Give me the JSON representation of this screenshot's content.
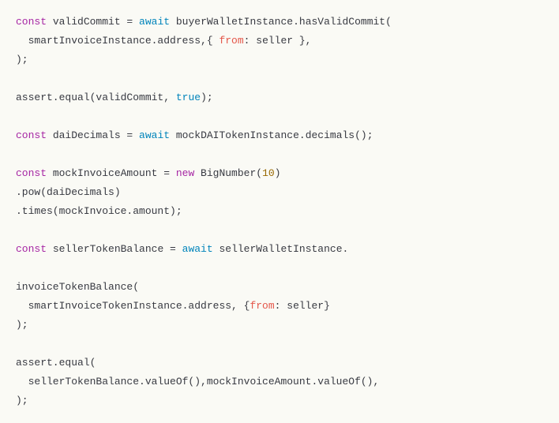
{
  "code": {
    "tokens": [
      {
        "cls": "tok-keyword",
        "t": "const"
      },
      {
        "cls": "tok-plain",
        "t": " validCommit = "
      },
      {
        "cls": "tok-await",
        "t": "await"
      },
      {
        "cls": "tok-plain",
        "t": " buyerWalletInstance.hasValidCommit(\n  smartInvoiceInstance.address,{ "
      },
      {
        "cls": "tok-prop",
        "t": "from"
      },
      {
        "cls": "tok-plain",
        "t": ": seller },\n);\n\nassert.equal(validCommit, "
      },
      {
        "cls": "tok-bool",
        "t": "true"
      },
      {
        "cls": "tok-plain",
        "t": ");\n\n"
      },
      {
        "cls": "tok-keyword",
        "t": "const"
      },
      {
        "cls": "tok-plain",
        "t": " daiDecimals = "
      },
      {
        "cls": "tok-await",
        "t": "await"
      },
      {
        "cls": "tok-plain",
        "t": " mockDAITokenInstance.decimals();\n\n"
      },
      {
        "cls": "tok-keyword",
        "t": "const"
      },
      {
        "cls": "tok-plain",
        "t": " mockInvoiceAmount = "
      },
      {
        "cls": "tok-keyword",
        "t": "new"
      },
      {
        "cls": "tok-plain",
        "t": " BigNumber("
      },
      {
        "cls": "tok-number",
        "t": "10"
      },
      {
        "cls": "tok-plain",
        "t": ")\n.pow(daiDecimals)\n.times(mockInvoice.amount);\n\n"
      },
      {
        "cls": "tok-keyword",
        "t": "const"
      },
      {
        "cls": "tok-plain",
        "t": " sellerTokenBalance = "
      },
      {
        "cls": "tok-await",
        "t": "await"
      },
      {
        "cls": "tok-plain",
        "t": " sellerWalletInstance.\n\ninvoiceTokenBalance(\n  smartInvoiceTokenInstance.address, {"
      },
      {
        "cls": "tok-prop",
        "t": "from"
      },
      {
        "cls": "tok-plain",
        "t": ": seller}\n);\n\nassert.equal(\n  sellerTokenBalance.valueOf(),mockInvoiceAmount.valueOf(),\n);"
      }
    ]
  }
}
